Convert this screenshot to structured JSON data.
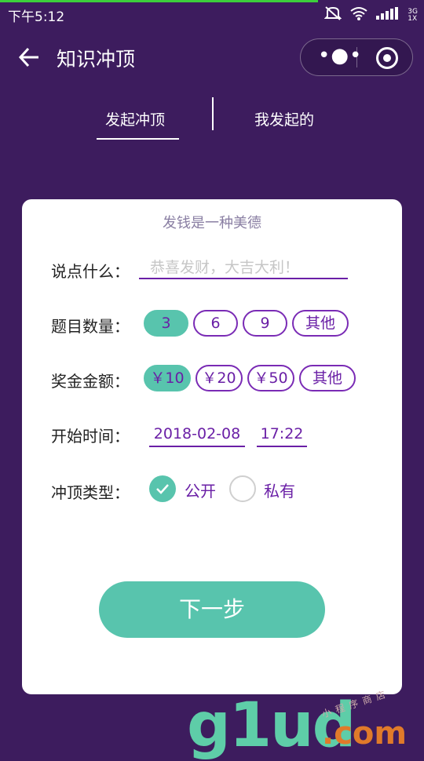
{
  "status_bar": {
    "time": "下午5:12",
    "icons": [
      "mute-icon",
      "wifi-icon",
      "signal-icon"
    ],
    "network_type": "3G",
    "network_sub": "1X"
  },
  "nav": {
    "title": "知识冲顶",
    "more_glyph": "•●•"
  },
  "tabs": [
    {
      "label": "发起冲顶",
      "active": true
    },
    {
      "label": "我发起的",
      "active": false
    }
  ],
  "card": {
    "motto": "发钱是一种美德",
    "message": {
      "label": "说点什么：",
      "placeholder": "恭喜发财，大吉大利！"
    },
    "question_count": {
      "label": "题目数量：",
      "options": [
        "3",
        "6",
        "9",
        "其他"
      ],
      "selected": "3"
    },
    "prize": {
      "label": "奖金金额：",
      "options": [
        "￥10",
        "￥20",
        "￥50",
        "其他"
      ],
      "selected": "￥10"
    },
    "start_time": {
      "label": "开始时间：",
      "date": "2018-02-08",
      "time": "17:22"
    },
    "type": {
      "label": "冲顶类型：",
      "options": [
        "公开",
        "私有"
      ],
      "selected": "公开"
    },
    "next_button": "下一步"
  },
  "watermark": {
    "main": "g1ud",
    "suffix": ".com",
    "small": "小程序商店"
  },
  "colors": {
    "background": "#3d1c5e",
    "accent_teal": "#58c4ad",
    "accent_purple": "#6a1fa6",
    "card": "#ffffff"
  }
}
